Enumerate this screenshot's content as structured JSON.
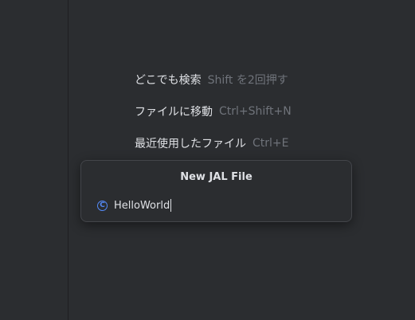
{
  "hints": [
    {
      "label": "どこでも検索",
      "shortcut": "Shift を2回押す"
    },
    {
      "label": "ファイルに移動",
      "shortcut": "Ctrl+Shift+N"
    },
    {
      "label": "最近使用したファイル",
      "shortcut": "Ctrl+E"
    }
  ],
  "popup": {
    "title": "New JAL File",
    "icon": "class-icon",
    "icon_glyph": "C",
    "value": "HelloWorld"
  },
  "colors": {
    "background": "#2b2d30",
    "text": "#dfe1e5",
    "shortcut": "#6f737a",
    "accent": "#548af7"
  }
}
